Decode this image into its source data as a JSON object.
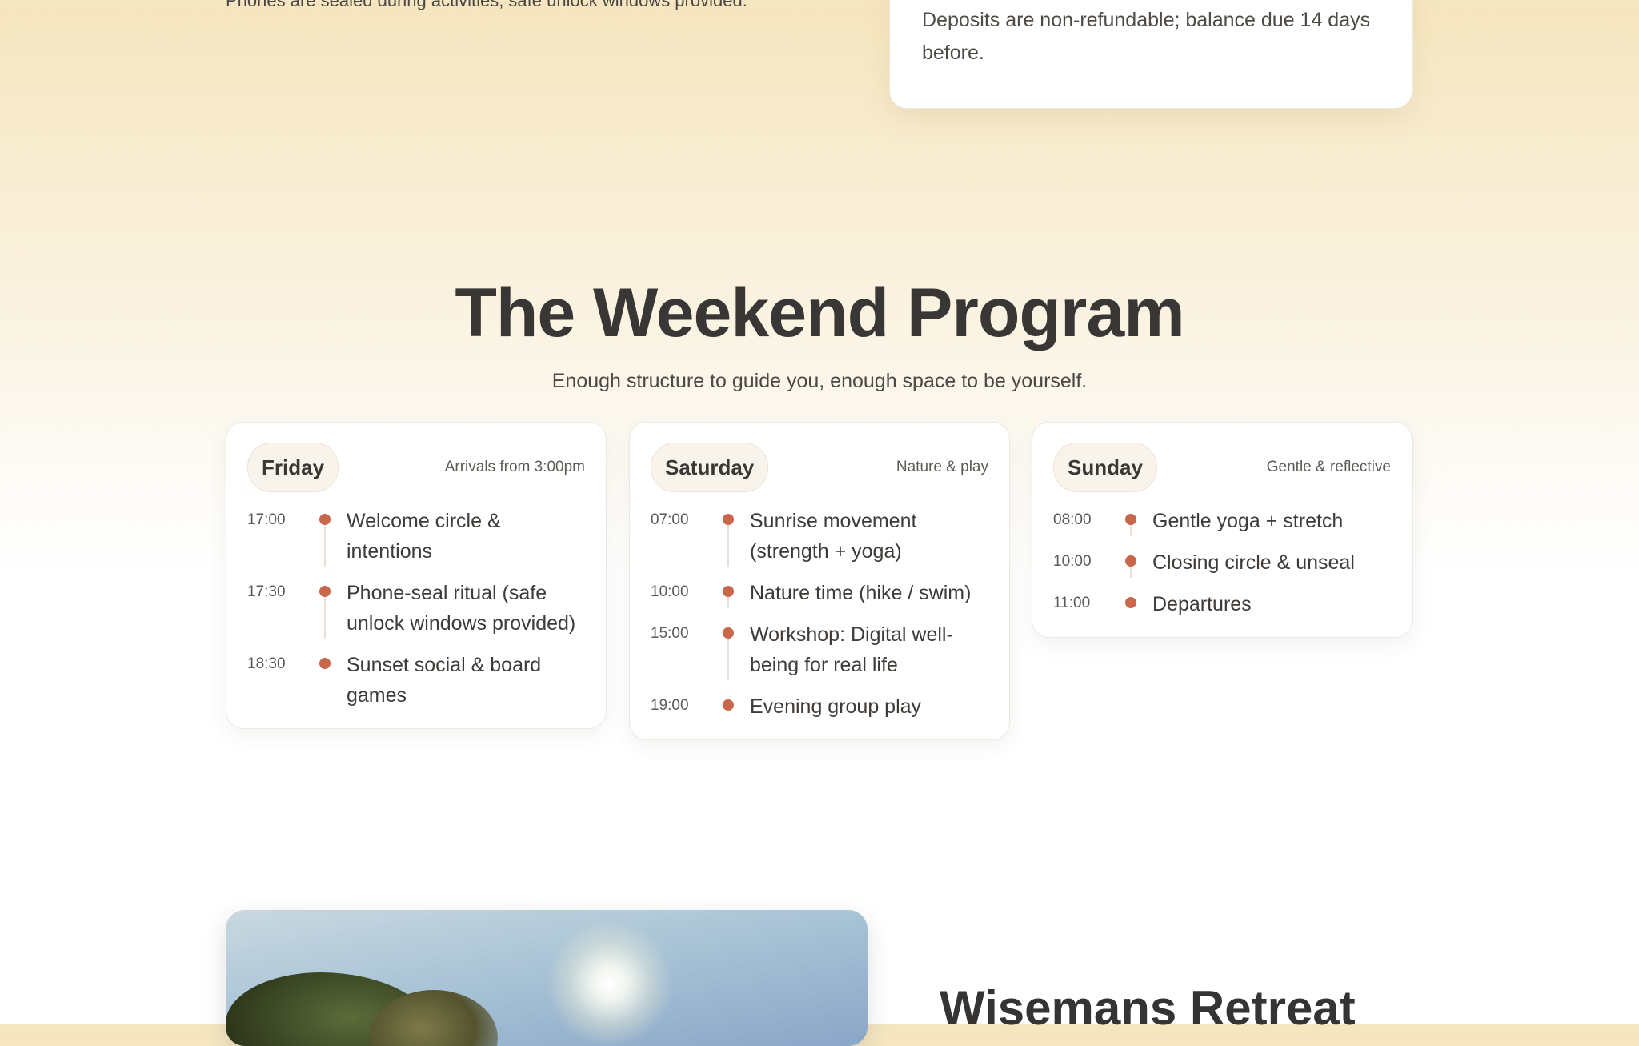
{
  "prev_section": {
    "clipped_line": "Phones are sealed during activities; safe unlock windows provided.",
    "policy_text": "Deposits are non-refundable; balance due 14 days before."
  },
  "program": {
    "title": "The Weekend Program",
    "subtitle": "Enough structure to guide you, enough space to be yourself.",
    "days": [
      {
        "day": "Friday",
        "note": "Arrivals from 3:00pm",
        "events": [
          {
            "time": "17:00",
            "title": "Welcome circle & intentions"
          },
          {
            "time": "17:30",
            "title": "Phone-seal ritual (safe unlock windows provided)"
          },
          {
            "time": "18:30",
            "title": "Sunset social & board games"
          }
        ]
      },
      {
        "day": "Saturday",
        "note": "Nature & play",
        "events": [
          {
            "time": "07:00",
            "title": "Sunrise movement (strength + yoga)"
          },
          {
            "time": "10:00",
            "title": "Nature time (hike / swim)"
          },
          {
            "time": "15:00",
            "title": "Workshop: Digital well-being for real life"
          },
          {
            "time": "19:00",
            "title": "Evening group play"
          }
        ]
      },
      {
        "day": "Sunday",
        "note": "Gentle & reflective",
        "events": [
          {
            "time": "08:00",
            "title": "Gentle yoga + stretch"
          },
          {
            "time": "10:00",
            "title": "Closing circle & unseal"
          },
          {
            "time": "11:00",
            "title": "Departures"
          }
        ]
      }
    ]
  },
  "next_section": {
    "title": "Wisemans Retreat"
  },
  "colors": {
    "accent_dot": "#c9674b",
    "heading": "#393735",
    "background_top": "#f6e6bf"
  }
}
